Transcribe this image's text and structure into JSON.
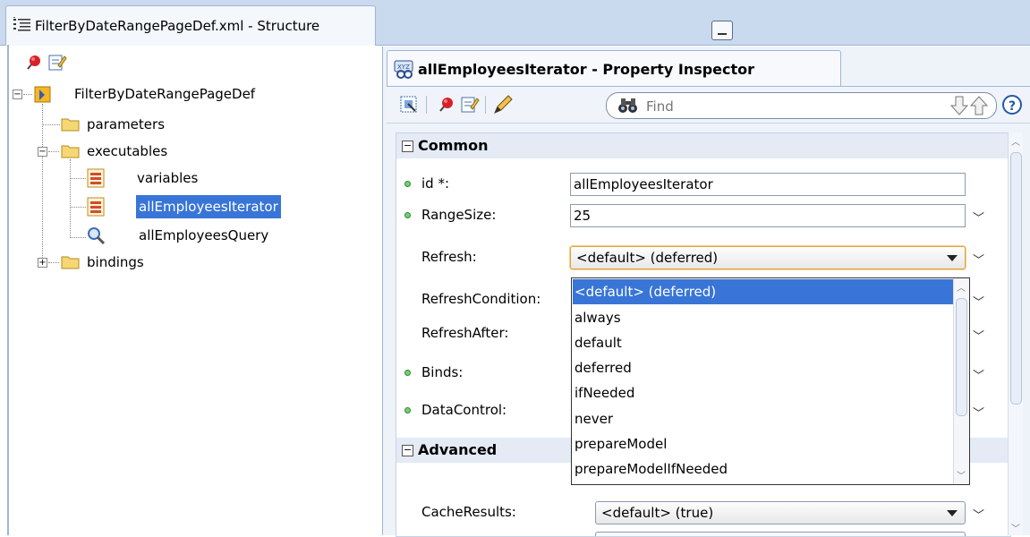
{
  "structure": {
    "title": "FilterByDateRangePageDef.xml - Structure",
    "tree": {
      "root": "FilterByDateRangePageDef",
      "parameters": "parameters",
      "executables": "executables",
      "variables": "variables",
      "iterator": "allEmployeesIterator",
      "query": "allEmployeesQuery",
      "bindings": "bindings"
    }
  },
  "inspector": {
    "title": "allEmployeesIterator - Property Inspector",
    "find_placeholder": "Find",
    "help_label": "?",
    "sections": {
      "common": "Common",
      "advanced": "Advanced"
    },
    "props": {
      "id_label": "id *:",
      "id_value": "allEmployeesIterator",
      "rangesize_label": "RangeSize:",
      "rangesize_value": "25",
      "refresh_label": "Refresh:",
      "refresh_value": "<default> (deferred)",
      "refreshcondition_label": "RefreshCondition:",
      "refreshafter_label": "RefreshAfter:",
      "binds_label": "Binds:",
      "datacontrol_label": "DataControl:",
      "cacheresults_label": "CacheResults:",
      "cacheresults_value": "<default> (true)"
    }
  },
  "dropdown": {
    "options": [
      "<default> (deferred)",
      "always",
      "default",
      "deferred",
      "ifNeeded",
      "never",
      "prepareModel",
      "prepareModelIfNeeded"
    ],
    "selected_index": 0
  },
  "colors": {
    "selection": "#3875d7",
    "panel_bg": "#eef3fa",
    "tab_strip": "#c9d9ee"
  }
}
